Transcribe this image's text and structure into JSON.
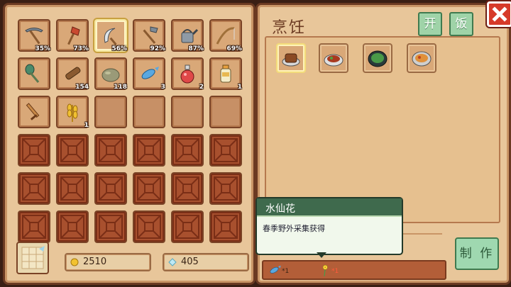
{
  "inventory": {
    "slots": [
      {
        "icon": "pickaxe-icon",
        "badge": "35%"
      },
      {
        "icon": "axe-icon",
        "badge": "73%"
      },
      {
        "icon": "sickle-icon",
        "badge": "56%",
        "selected": true
      },
      {
        "icon": "hoe-icon",
        "badge": "92%"
      },
      {
        "icon": "watering-can-icon",
        "badge": "87%"
      },
      {
        "icon": "fishing-rod-icon",
        "badge": "69%"
      },
      {
        "icon": "shovel-icon",
        "badge": ""
      },
      {
        "icon": "wood-log-icon",
        "badge": "154"
      },
      {
        "icon": "stone-icon",
        "badge": "118"
      },
      {
        "icon": "fish-icon",
        "badge": "3"
      },
      {
        "icon": "red-potion-icon",
        "badge": "2"
      },
      {
        "icon": "milk-bottle-icon",
        "badge": "1"
      },
      {
        "icon": "wooden-sword-icon",
        "badge": ""
      },
      {
        "icon": "wheat-icon",
        "badge": "1"
      }
    ],
    "empty_open_slots": 4,
    "locked_slots": 18
  },
  "currency": {
    "gold": "2510",
    "gems": "405",
    "gold_icon": "gold-coin-icon",
    "gem_icon": "gem-icon"
  },
  "cooking": {
    "title": "烹饪",
    "tabs": [
      "开",
      "饭"
    ],
    "recipes": [
      {
        "icon": "bread-dish-icon",
        "selected": true
      },
      {
        "icon": "meat-stew-dish-icon"
      },
      {
        "icon": "green-soup-dish-icon"
      },
      {
        "icon": "curry-dish-icon"
      }
    ],
    "ingredients": [
      {
        "icon": "fish-icon",
        "count": "*1",
        "ok": true
      },
      {
        "icon": "daffodil-icon",
        "count": "*1",
        "ok": false
      }
    ],
    "craft_label": "制 作"
  },
  "tooltip": {
    "title": "水仙花",
    "description": "春季野外采集获得"
  },
  "colors": {
    "panel": "#e8c69a",
    "border": "#6b3a22",
    "green_button": "#9fd8b0",
    "close": "#d63a2a"
  }
}
